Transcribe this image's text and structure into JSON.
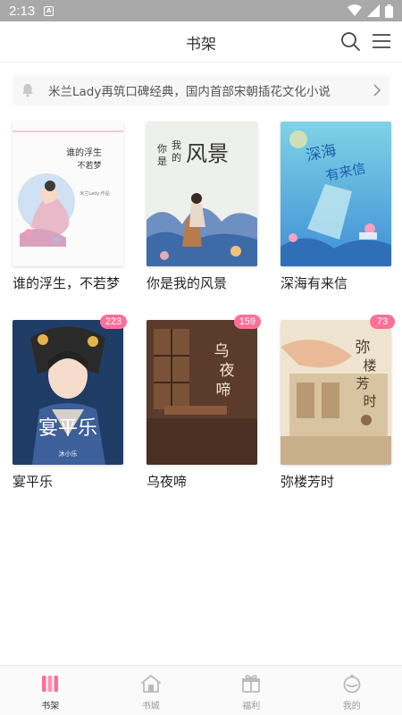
{
  "status_bar": {
    "time": "2:13",
    "notif_glyph": "A"
  },
  "header": {
    "title": "书架"
  },
  "notice": {
    "text": "米兰Lady再筑口碑经典，国内首部宋朝插花文化小说"
  },
  "books": [
    {
      "title": "谁的浮生，不若梦",
      "badge": "",
      "cover_title": "谁的浮生\n不若梦",
      "cover_sub": "米兰Lady·作品"
    },
    {
      "title": "你是我的风景",
      "badge": "",
      "cover_title": "你是我的风景",
      "cover_sub": ""
    },
    {
      "title": "深海有来信",
      "badge": "",
      "cover_title": "深海有来信",
      "cover_sub": ""
    },
    {
      "title": "宴平乐",
      "badge": "223",
      "cover_title": "宴平乐",
      "cover_sub": "沐小乐"
    },
    {
      "title": "乌夜啼",
      "badge": "159",
      "cover_title": "乌夜啼",
      "cover_sub": ""
    },
    {
      "title": "弥楼芳时",
      "badge": "73",
      "cover_title": "弥楼芳时",
      "cover_sub": ""
    }
  ],
  "tabs": [
    {
      "label": "书架",
      "icon": "bookshelf-icon",
      "active": true
    },
    {
      "label": "书城",
      "icon": "bookstore-icon",
      "active": false
    },
    {
      "label": "福利",
      "icon": "gift-icon",
      "active": false
    },
    {
      "label": "我的",
      "icon": "profile-icon",
      "active": false
    }
  ],
  "colors": {
    "accent": "#ff6f9a",
    "status_bar": "#a9a9a9"
  }
}
